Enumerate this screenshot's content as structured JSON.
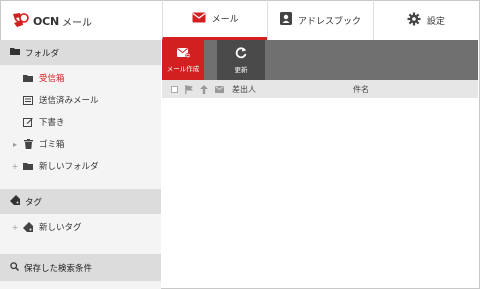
{
  "app": {
    "brand": "OCN",
    "name": "メール"
  },
  "topnav": [
    {
      "label": "メール",
      "icon": "envelope-icon",
      "active": true
    },
    {
      "label": "アドレスブック",
      "icon": "contact-card-icon",
      "active": false
    },
    {
      "label": "設定",
      "icon": "gear-icon",
      "active": false
    }
  ],
  "sidebar": {
    "folders_header": "フォルダ",
    "folders": [
      {
        "label": "受信箱",
        "icon": "folder-icon",
        "active": true
      },
      {
        "label": "送信済みメール",
        "icon": "sent-mail-icon",
        "active": false
      },
      {
        "label": "下書き",
        "icon": "draft-edit-icon",
        "active": false
      },
      {
        "label": "ゴミ箱",
        "icon": "trash-icon",
        "active": false
      },
      {
        "label": "新しいフォルダ",
        "icon": "folder-icon",
        "active": false
      }
    ],
    "tags_header": "タグ",
    "new_tag": "新しいタグ",
    "saved_search": "保存した検索条件"
  },
  "toolbar": {
    "compose": "メール作成",
    "refresh": "更新"
  },
  "list": {
    "from_header": "差出人",
    "subject_header": "件名"
  },
  "colors": {
    "accent": "#d21f1f",
    "toolbar": "#707070",
    "sidebar_header": "#dcdcdc"
  }
}
